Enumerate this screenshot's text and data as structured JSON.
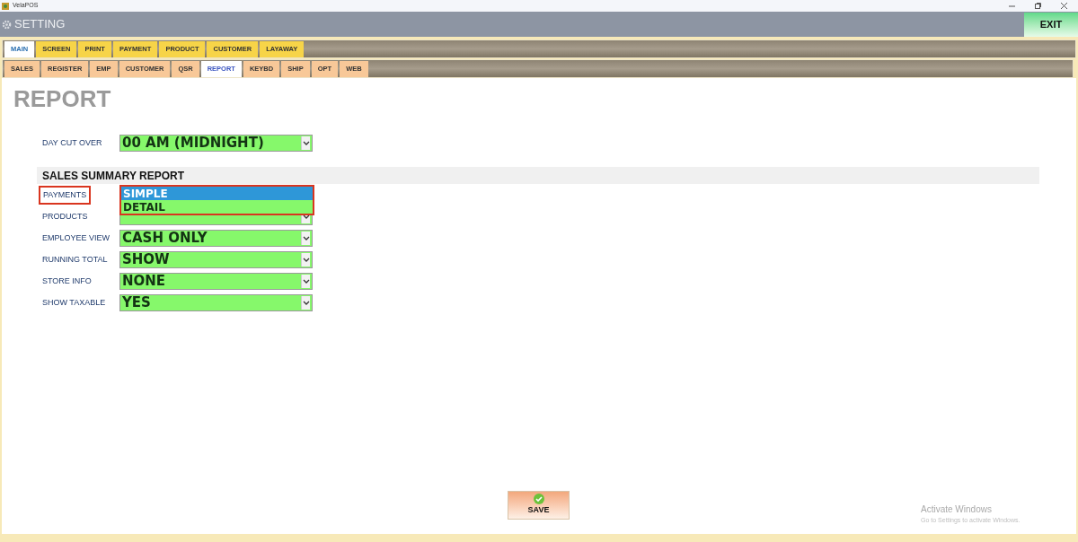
{
  "window": {
    "title": "VelaPOS"
  },
  "header": {
    "title": "SETTING",
    "exit": "EXIT"
  },
  "main_tabs": [
    {
      "label": "MAIN",
      "selected": true
    },
    {
      "label": "SCREEN",
      "selected": false
    },
    {
      "label": "PRINT",
      "selected": false
    },
    {
      "label": "PAYMENT",
      "selected": false
    },
    {
      "label": "PRODUCT",
      "selected": false
    },
    {
      "label": "CUSTOMER",
      "selected": false
    },
    {
      "label": "LAYAWAY",
      "selected": false
    }
  ],
  "sub_tabs": [
    {
      "label": "SALES",
      "selected": false
    },
    {
      "label": "REGISTER",
      "selected": false
    },
    {
      "label": "EMP",
      "selected": false
    },
    {
      "label": "CUSTOMER",
      "selected": false
    },
    {
      "label": "QSR",
      "selected": false
    },
    {
      "label": "REPORT",
      "selected": true
    },
    {
      "label": "KEYBD",
      "selected": false
    },
    {
      "label": "SHIP",
      "selected": false
    },
    {
      "label": "OPT",
      "selected": false
    },
    {
      "label": "WEB",
      "selected": false
    }
  ],
  "page_title": "REPORT",
  "day_cut_over": {
    "label": "DAY CUT OVER",
    "value": "00 AM (MIDNIGHT)"
  },
  "section": {
    "title": "SALES SUMMARY REPORT"
  },
  "rows": [
    {
      "label": "PAYMENTS",
      "highlighted": true,
      "options": [
        {
          "label": "SIMPLE",
          "selected": true
        },
        {
          "label": "DETAIL",
          "selected": false
        }
      ]
    },
    {
      "label": "PRODUCTS",
      "highlighted": false
    },
    {
      "label": "EMPLOYEE VIEW",
      "highlighted": false,
      "value": "CASH ONLY"
    },
    {
      "label": "RUNNING TOTAL",
      "highlighted": false,
      "value": "SHOW"
    },
    {
      "label": "STORE INFO",
      "highlighted": false,
      "value": "NONE"
    },
    {
      "label": "SHOW TAXABLE",
      "highlighted": false,
      "value": "YES"
    }
  ],
  "save": "SAVE",
  "activation": {
    "title": "Activate Windows",
    "subtitle": "Go to Settings to activate Windows."
  }
}
